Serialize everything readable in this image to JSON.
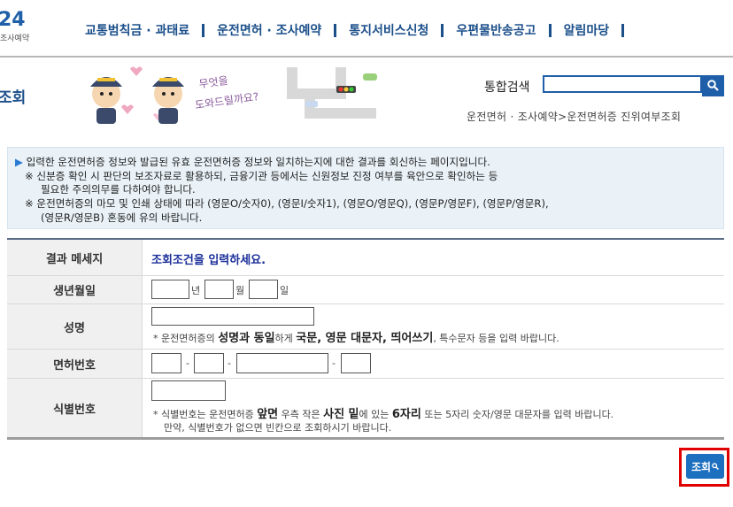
{
  "logo": {
    "number": "24",
    "sub": "조사예약"
  },
  "topnav": [
    {
      "label": "교통범칙금 · 과태료"
    },
    {
      "label": "운전면허 · 조사예약"
    },
    {
      "label": "통지서비스신청"
    },
    {
      "label": "우편물반송공고"
    },
    {
      "label": "알림마당"
    }
  ],
  "header": {
    "page_title": "조회",
    "search_label": "통합검색",
    "search_value": "",
    "breadcrumb": "운전면허 · 조사예약>운전면허증 진위여부조회",
    "illustration_text": [
      "무엇을",
      "도와드릴까요?"
    ]
  },
  "notice": {
    "lines": [
      "입력한 운전면허증 정보와 발급된 유효 운전면허증 정보와 일치하는지에 대한 결과를 회신하는 페이지입니다.",
      "※ 신분증 확인 시 판단의 보조자료로 활용하되, 금융기관 등에서는 신원정보 진정 여부를 육안으로 확인하는 등",
      "필요한 주의의무를 다하여야 합니다.",
      "※ 운전면허증의 마모 및 인쇄 상태에 따라 (영문O/숫자0), (영문I/숫자1), (영문O/영문Q), (영문P/영문F), (영문P/영문R),",
      "(영문R/영문B) 혼동에 유의 바랍니다."
    ]
  },
  "form": {
    "result_label": "결과 메세지",
    "result_message": "조회조건을 입력하세요.",
    "birth_label": "생년월일",
    "birth_year_unit": "년",
    "birth_month_unit": "월",
    "birth_day_unit": "일",
    "name_label": "성명",
    "name_note_a": "* 운전면허증의 ",
    "name_note_b": "성명과 동일",
    "name_note_c": "하게 ",
    "name_note_d": "국문, 영문 대문자, 띄어쓰기",
    "name_note_e": ", 특수문자 등을 입력 바랍니다.",
    "license_label": "면허번호",
    "dash": "-",
    "id_label": "식별번호",
    "id_note_a": "* 식별번호는 운전면허증 ",
    "id_note_b": "앞면",
    "id_note_c": " 우측 작은 ",
    "id_note_d": "사진 밑",
    "id_note_e": "에 있는 ",
    "id_note_f": "6자리",
    "id_note_g": " 또는 5자리 숫자/영문 대문자를 입력 바랍니다.",
    "id_note2": "만약, 식별번호가 없으면 빈칸으로 조회하시기 바랍니다."
  },
  "submit": {
    "label": "조회"
  },
  "colors": {
    "brand": "#1b4f8a",
    "accent": "#1f5ea9",
    "highlight": "#e10000"
  }
}
